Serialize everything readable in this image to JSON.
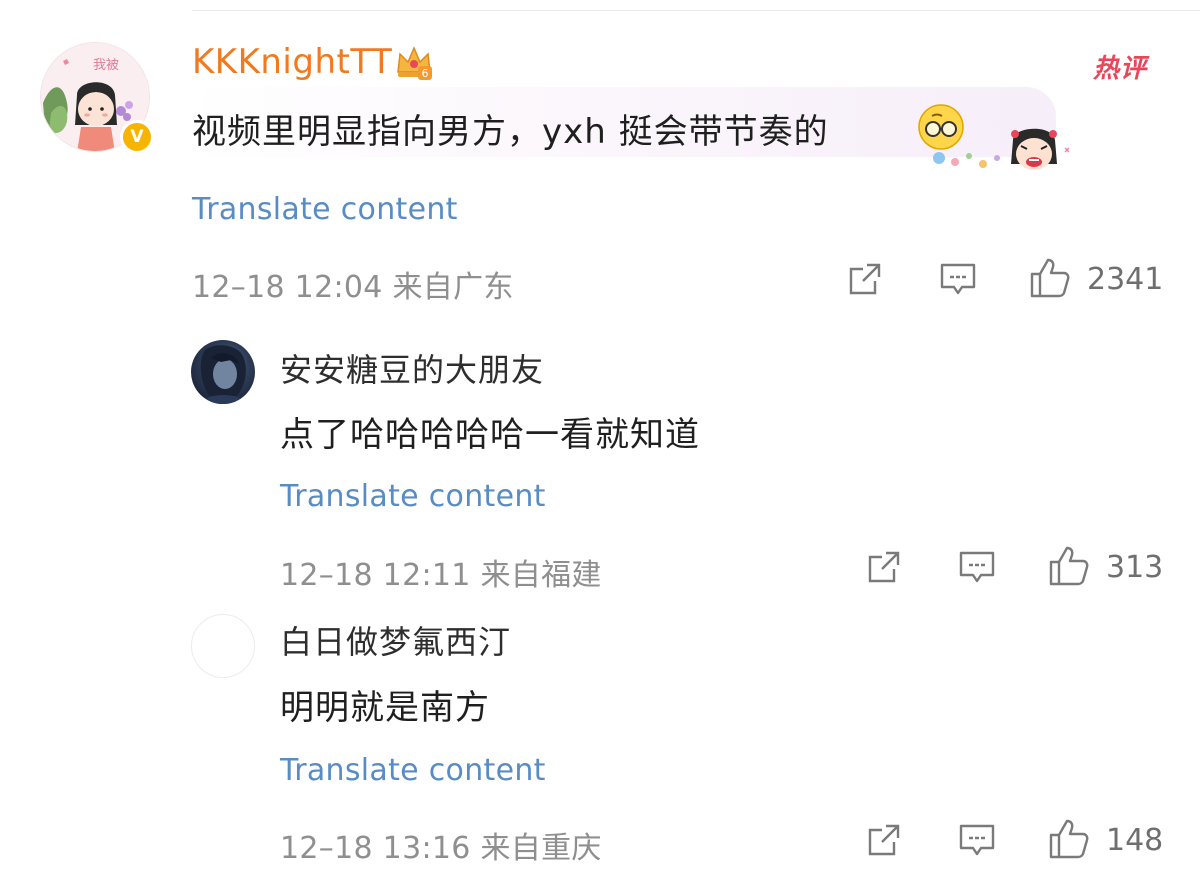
{
  "main_comment": {
    "username": "KKKnightTT",
    "crown_level": "6",
    "verified_mark": "V",
    "hot_label": "热评",
    "text": "视频里明显指向男方，yxh 挺会带节奏的",
    "translate_label": "Translate content",
    "meta": "12–18 12:04 来自广东",
    "likes": "2341",
    "username_color": "#f07a1f",
    "hot_color": "#e8475a"
  },
  "replies": [
    {
      "username": "安安糖豆的大朋友",
      "text": "点了哈哈哈哈哈一看就知道",
      "translate_label": "Translate content",
      "meta": "12–18 12:11 来自福建",
      "likes": "313"
    },
    {
      "username": "白日做梦氟西汀",
      "text": "明明就是南方",
      "translate_label": "Translate content",
      "meta": "12–18 13:16 来自重庆",
      "likes": "148"
    }
  ],
  "icons": {
    "share": "share-icon",
    "comment": "comment-icon",
    "like": "thumbs-up-icon",
    "crown": "crown-icon",
    "emoji": "glasses-face-emoji-icon"
  },
  "colors": {
    "link": "#5a8cc4",
    "meta": "#8f8f8f"
  }
}
